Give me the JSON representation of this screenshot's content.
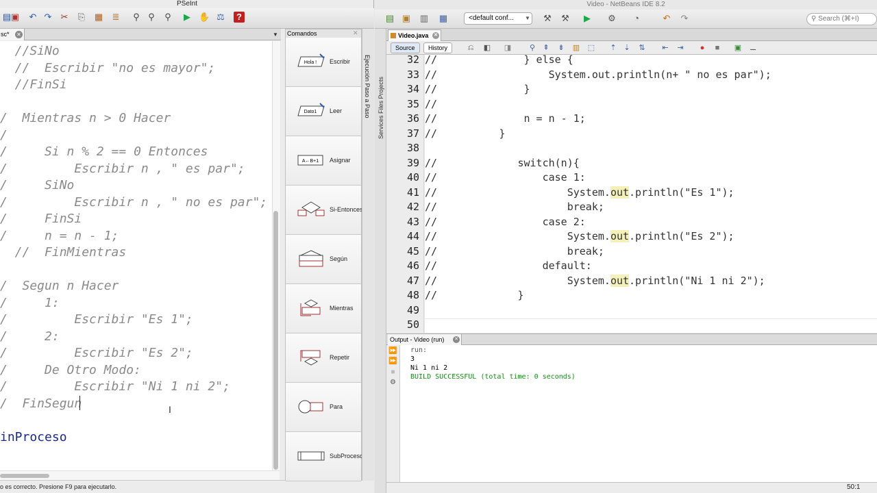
{
  "pseint": {
    "title": "PSeInt",
    "tab": {
      "label": "sc*"
    },
    "code_lines": [
      {
        "text": "  //SiNo",
        "kw": false
      },
      {
        "text": "  //  Escribir \"no es mayor\";",
        "kw": false
      },
      {
        "text": "  //FinSi",
        "kw": false
      },
      {
        "text": "",
        "kw": false
      },
      {
        "text": "/  Mientras n > 0 Hacer",
        "kw": false
      },
      {
        "text": "/",
        "kw": false
      },
      {
        "text": "/     Si n % 2 == 0 Entonces",
        "kw": false
      },
      {
        "text": "/         Escribir n , \" es par\";",
        "kw": false
      },
      {
        "text": "/     SiNo",
        "kw": false
      },
      {
        "text": "/         Escribir n , \" no es par\";",
        "kw": false
      },
      {
        "text": "/     FinSi",
        "kw": false
      },
      {
        "text": "/     n = n - 1;",
        "kw": false
      },
      {
        "text": "  //  FinMientras",
        "kw": false
      },
      {
        "text": "",
        "kw": false
      },
      {
        "text": "/  Segun n Hacer",
        "kw": false
      },
      {
        "text": "/     1:",
        "kw": false
      },
      {
        "text": "/         Escribir \"Es 1\";",
        "kw": false
      },
      {
        "text": "/     2:",
        "kw": false
      },
      {
        "text": "/         Escribir \"Es 2\";",
        "kw": false
      },
      {
        "text": "/     De Otro Modo:",
        "kw": false
      },
      {
        "text": "/         Escribir \"Ni 1 ni 2\";",
        "kw": false
      },
      {
        "text": "/  FinSegun",
        "kw": false
      },
      {
        "text": "",
        "kw": false
      },
      {
        "text": "inProceso",
        "kw": true
      }
    ],
    "status": "o es correcto. Presione F9 para ejecutarlo.",
    "commands": {
      "header": "Comandos",
      "items": [
        {
          "label": "Escribir",
          "icon": "escribir-icon",
          "icon_text": "Hola !"
        },
        {
          "label": "Leer",
          "icon": "leer-icon",
          "icon_text": "Dato1"
        },
        {
          "label": "Asignar",
          "icon": "asignar-icon",
          "icon_text": "A←B+1"
        },
        {
          "label": "Si-Entonces",
          "icon": "si-entonces-icon",
          "icon_text": ""
        },
        {
          "label": "Según",
          "icon": "segun-icon",
          "icon_text": ""
        },
        {
          "label": "Mientras",
          "icon": "mientras-icon",
          "icon_text": ""
        },
        {
          "label": "Repetir",
          "icon": "repetir-icon",
          "icon_text": ""
        },
        {
          "label": "Para",
          "icon": "para-icon",
          "icon_text": ""
        },
        {
          "label": "SubProceso",
          "icon": "subproceso-icon",
          "icon_text": "y←f(x)"
        }
      ]
    },
    "side_tab": "Ejecución Paso a Paso"
  },
  "netbeans": {
    "title": "Video - NetBeans IDE 8.2",
    "config": "<default conf...",
    "search_placeholder": "Search (⌘+I)",
    "side_tabs": "Services   Files   Projects",
    "editor_tab": "Video.java",
    "source_btn": "Source",
    "history_btn": "History",
    "code": [
      {
        "n": "32",
        "parts": [
          {
            "t": "//              } else {",
            "h": false
          }
        ]
      },
      {
        "n": "33",
        "parts": [
          {
            "t": "//                  System.out.println(n+ \" no es par\");",
            "h": false
          }
        ]
      },
      {
        "n": "34",
        "parts": [
          {
            "t": "//              }",
            "h": false
          }
        ]
      },
      {
        "n": "35",
        "parts": [
          {
            "t": "//",
            "h": false
          }
        ]
      },
      {
        "n": "36",
        "parts": [
          {
            "t": "//              n = n - 1;",
            "h": false
          }
        ]
      },
      {
        "n": "37",
        "parts": [
          {
            "t": "//          }",
            "h": false
          }
        ]
      },
      {
        "n": "38",
        "parts": [
          {
            "t": "",
            "h": false
          }
        ]
      },
      {
        "n": "39",
        "parts": [
          {
            "t": "//             switch(n){",
            "h": false
          }
        ]
      },
      {
        "n": "40",
        "parts": [
          {
            "t": "//                 case 1:",
            "h": false
          }
        ]
      },
      {
        "n": "41",
        "parts": [
          {
            "t": "//                     System.",
            "h": false
          },
          {
            "t": "out",
            "h": true
          },
          {
            "t": ".println(\"Es 1\");",
            "h": false
          }
        ]
      },
      {
        "n": "42",
        "parts": [
          {
            "t": "//                     break;",
            "h": false
          }
        ]
      },
      {
        "n": "43",
        "parts": [
          {
            "t": "//                 case 2:",
            "h": false
          }
        ]
      },
      {
        "n": "44",
        "parts": [
          {
            "t": "//                     System.",
            "h": false
          },
          {
            "t": "out",
            "h": true
          },
          {
            "t": ".println(\"Es 2\");",
            "h": false
          }
        ]
      },
      {
        "n": "45",
        "parts": [
          {
            "t": "//                     break;",
            "h": false
          }
        ]
      },
      {
        "n": "46",
        "parts": [
          {
            "t": "//                 default:",
            "h": false
          }
        ]
      },
      {
        "n": "47",
        "parts": [
          {
            "t": "//                     System.",
            "h": false
          },
          {
            "t": "out",
            "h": true
          },
          {
            "t": ".println(\"Ni 1 ni 2\");",
            "h": false
          }
        ]
      },
      {
        "n": "48",
        "parts": [
          {
            "t": "//             }",
            "h": false
          }
        ]
      },
      {
        "n": "49",
        "parts": [
          {
            "t": "",
            "h": false
          }
        ]
      },
      {
        "n": "50",
        "parts": [
          {
            "t": "",
            "h": false
          }
        ]
      }
    ],
    "output_tab": "Output - Video (run)",
    "output": [
      {
        "text": "run:",
        "color": "#555555"
      },
      {
        "text": "3",
        "color": "#000000"
      },
      {
        "text": "Ni 1 ni 2",
        "color": "#000000"
      },
      {
        "text": "BUILD SUCCESSFUL (total time: 0 seconds)",
        "color": "#1a8a1a"
      }
    ],
    "position": "50:1"
  }
}
